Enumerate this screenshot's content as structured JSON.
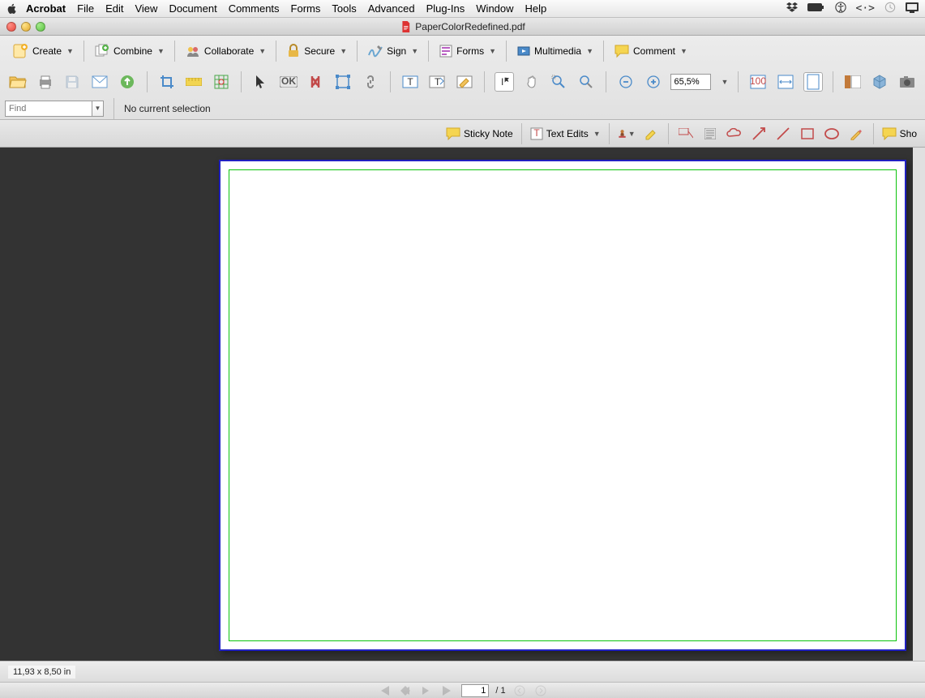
{
  "menubar": {
    "app": "Acrobat",
    "items": [
      "File",
      "Edit",
      "View",
      "Document",
      "Comments",
      "Forms",
      "Tools",
      "Advanced",
      "Plug-Ins",
      "Window",
      "Help"
    ]
  },
  "window": {
    "title": "PaperColorRedefined.pdf"
  },
  "toolbar1": {
    "create": "Create",
    "combine": "Combine",
    "collaborate": "Collaborate",
    "secure": "Secure",
    "sign": "Sign",
    "forms": "Forms",
    "multimedia": "Multimedia",
    "comment": "Comment"
  },
  "toolbar2": {
    "zoom_value": "65,5%"
  },
  "find": {
    "placeholder": "Find",
    "selection": "No current selection"
  },
  "annot": {
    "sticky": "Sticky Note",
    "textedits": "Text Edits",
    "show": "Sho"
  },
  "status": {
    "dims": "11,93 x 8,50 in"
  },
  "nav": {
    "page": "1",
    "total": "/  1"
  }
}
